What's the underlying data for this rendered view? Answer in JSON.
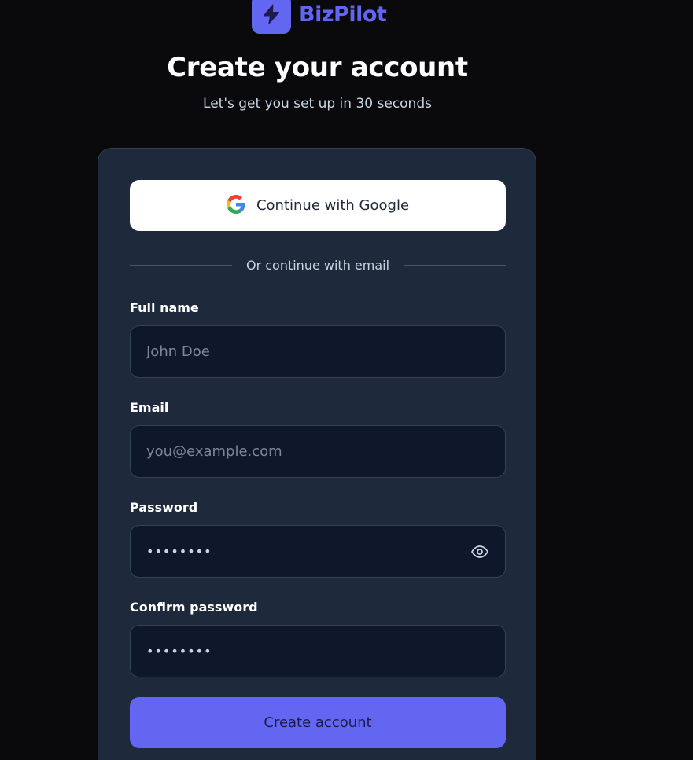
{
  "brand": {
    "name": "BizPilot",
    "icon": "bolt-icon",
    "accent_color": "#6366f1"
  },
  "heading": {
    "title": "Create your account",
    "subtitle": "Let's get you set up in 30 seconds"
  },
  "google_button": {
    "label": "Continue with Google",
    "icon": "google-icon"
  },
  "divider": {
    "text": "Or continue with email"
  },
  "form": {
    "full_name": {
      "label": "Full name",
      "placeholder": "John Doe",
      "value": ""
    },
    "email": {
      "label": "Email",
      "placeholder": "you@example.com",
      "value": ""
    },
    "password": {
      "label": "Password",
      "masked_value": "••••••••",
      "toggle_icon": "eye-icon"
    },
    "confirm_password": {
      "label": "Confirm password",
      "masked_value": "••••••••"
    }
  },
  "submit": {
    "label": "Create account"
  }
}
